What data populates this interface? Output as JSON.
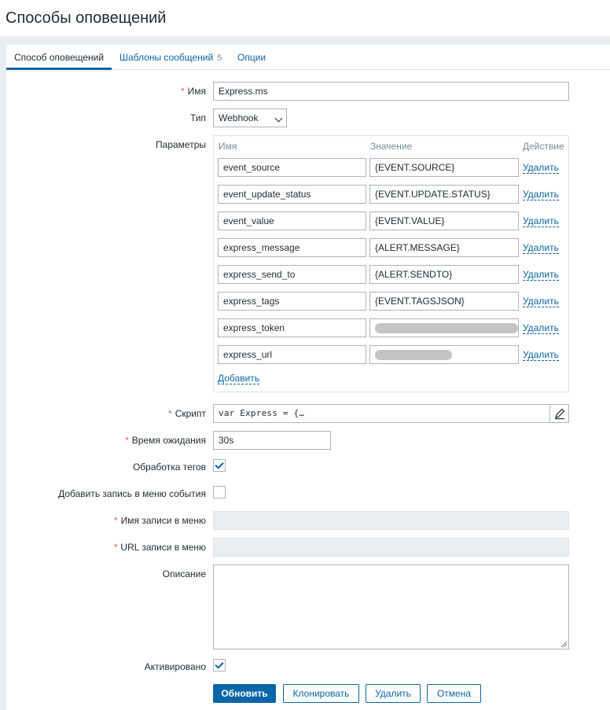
{
  "page": {
    "title": "Способы оповещений"
  },
  "tabs": [
    {
      "label": "Способ оповещений",
      "active": true
    },
    {
      "label": "Шаблоны сообщений",
      "count": "5"
    },
    {
      "label": "Опции"
    }
  ],
  "form": {
    "name": {
      "label": "Имя",
      "value": "Express.ms"
    },
    "type": {
      "label": "Тип",
      "value": "Webhook"
    },
    "params": {
      "label": "Параметры",
      "headers": {
        "name": "Имя",
        "value": "Значение",
        "action": "Действие"
      },
      "rows": [
        {
          "name": "event_source",
          "value": "{EVENT.SOURCE}",
          "action": "Удалить"
        },
        {
          "name": "event_update_status",
          "value": "{EVENT.UPDATE.STATUS}",
          "action": "Удалить"
        },
        {
          "name": "event_value",
          "value": "{EVENT.VALUE}",
          "action": "Удалить"
        },
        {
          "name": "express_message",
          "value": "{ALERT.MESSAGE}",
          "action": "Удалить"
        },
        {
          "name": "express_send_to",
          "value": "{ALERT.SENDTO}",
          "action": "Удалить"
        },
        {
          "name": "express_tags",
          "value": "{EVENT.TAGSJSON}",
          "action": "Удалить"
        },
        {
          "name": "express_token",
          "value": "",
          "action": "Удалить"
        },
        {
          "name": "express_url",
          "value": "",
          "action": "Удалить"
        }
      ],
      "add_label": "Добавить"
    },
    "script": {
      "label": "Скрипт",
      "value": "var Express = {…"
    },
    "timeout": {
      "label": "Время ожидания",
      "value": "30s"
    },
    "tag_processing": {
      "label": "Обработка тегов",
      "checked": true
    },
    "add_menu_entry": {
      "label": "Добавить запись в меню события",
      "checked": false
    },
    "menu_entry_name": {
      "label": "Имя записи в меню",
      "value": ""
    },
    "menu_entry_url": {
      "label": "URL записи в меню",
      "value": ""
    },
    "description": {
      "label": "Описание",
      "value": ""
    },
    "enabled": {
      "label": "Активировано",
      "checked": true
    }
  },
  "buttons": {
    "update": "Обновить",
    "clone": "Клонировать",
    "delete": "Удалить",
    "cancel": "Отмена"
  },
  "colors": {
    "accent": "#0a66a8",
    "required": "#e45959",
    "background": "#ebeef0"
  }
}
